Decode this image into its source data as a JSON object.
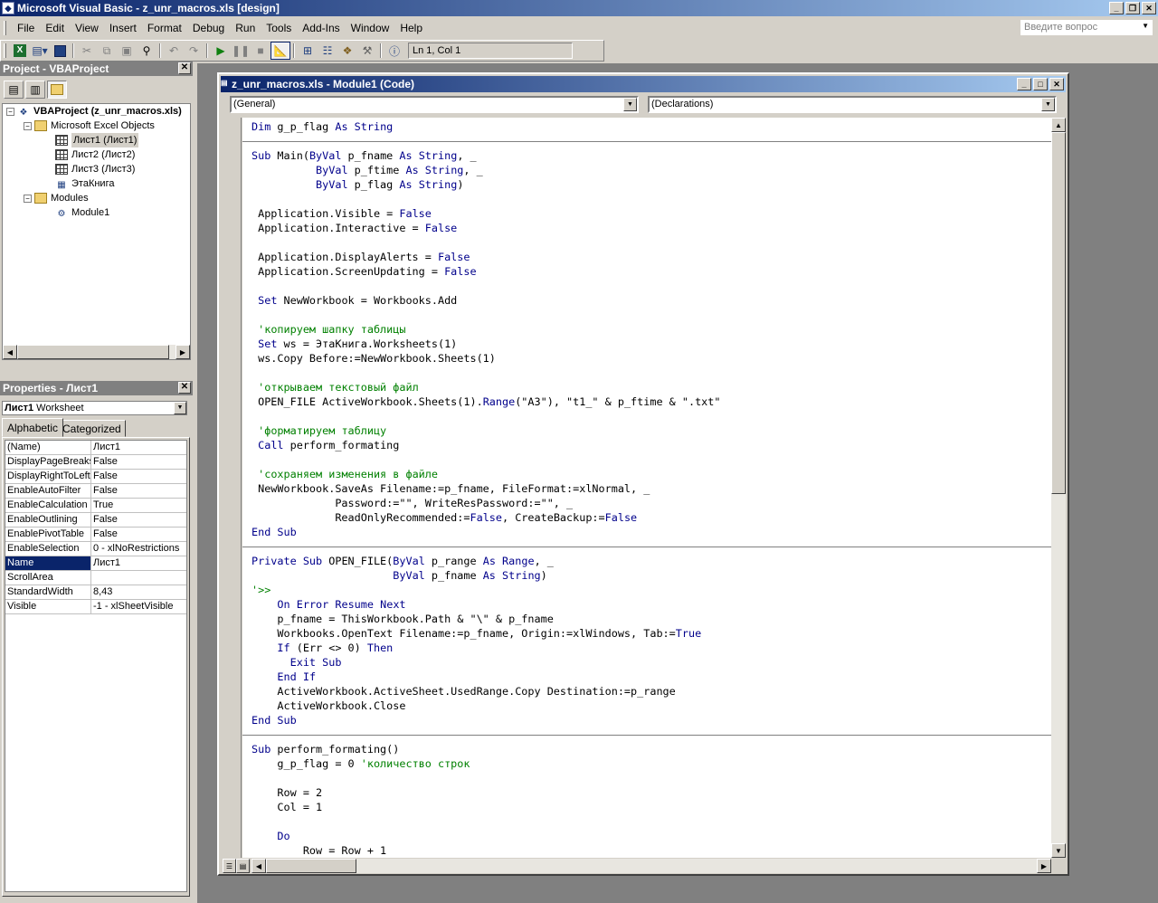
{
  "app": {
    "title": "Microsoft Visual Basic - z_unr_macros.xls [design]",
    "icon": "vb-app-icon"
  },
  "menu": [
    "File",
    "Edit",
    "View",
    "Insert",
    "Format",
    "Debug",
    "Run",
    "Tools",
    "Add-Ins",
    "Window",
    "Help"
  ],
  "help_placeholder": "Введите вопрос",
  "toolbar": {
    "status": "Ln 1, Col 1"
  },
  "project": {
    "title": "Project - VBAProject",
    "tree": [
      {
        "label": "VBAProject (z_unr_macros.xls)",
        "bold": true
      },
      {
        "label": "Microsoft Excel Objects"
      },
      {
        "label": "Лист1 (Лист1)"
      },
      {
        "label": "Лист2 (Лист2)"
      },
      {
        "label": "Лист3 (Лист3)"
      },
      {
        "label": "ЭтаКнига"
      },
      {
        "label": "Modules"
      },
      {
        "label": "Module1"
      }
    ]
  },
  "properties": {
    "title": "Properties - Лист1",
    "object": "Лист1",
    "object_type": "Worksheet",
    "tabs": [
      "Alphabetic",
      "Categorized"
    ],
    "rows": [
      {
        "name": "(Name)",
        "value": "Лист1"
      },
      {
        "name": "DisplayPageBreaks",
        "value": "False"
      },
      {
        "name": "DisplayRightToLeft",
        "value": "False"
      },
      {
        "name": "EnableAutoFilter",
        "value": "False"
      },
      {
        "name": "EnableCalculation",
        "value": "True"
      },
      {
        "name": "EnableOutlining",
        "value": "False"
      },
      {
        "name": "EnablePivotTable",
        "value": "False"
      },
      {
        "name": "EnableSelection",
        "value": "0 - xlNoRestrictions"
      },
      {
        "name": "Name",
        "value": "Лист1",
        "selected": true
      },
      {
        "name": "ScrollArea",
        "value": ""
      },
      {
        "name": "StandardWidth",
        "value": "8,43"
      },
      {
        "name": "Visible",
        "value": "-1 - xlSheetVisible"
      }
    ]
  },
  "code_window": {
    "title": "z_unr_macros.xls - Module1 (Code)",
    "object_combo": "(General)",
    "procedure_combo": "(Declarations)",
    "lines": [
      "Dim g_p_flag As String",
      "---",
      "Sub Main(ByVal p_fname As String, _",
      "          ByVal p_ftime As String, _",
      "          ByVal p_flag As String)",
      "",
      " Application.Visible = False",
      " Application.Interactive = False",
      "",
      " Application.DisplayAlerts = False",
      " Application.ScreenUpdating = False",
      "",
      " Set NewWorkbook = Workbooks.Add",
      "",
      " 'копируем шапку таблицы",
      " Set ws = ЭтаКнига.Worksheets(1)",
      " ws.Copy Before:=NewWorkbook.Sheets(1)",
      "",
      " 'открываем текстовый файл",
      " OPEN_FILE ActiveWorkbook.Sheets(1).Range(\"A3\"), \"t1_\" & p_ftime & \".txt\"",
      "",
      " 'форматируем таблицу",
      " Call perform_formating",
      "",
      " 'сохраняем изменения в файле",
      " NewWorkbook.SaveAs Filename:=p_fname, FileFormat:=xlNormal, _",
      "             Password:=\"\", WriteResPassword:=\"\", _",
      "             ReadOnlyRecommended:=False, CreateBackup:=False",
      "End Sub",
      "---",
      "Private Sub OPEN_FILE(ByVal p_range As Range, _",
      "                      ByVal p_fname As String)",
      "'>>",
      "    On Error Resume Next",
      "    p_fname = ThisWorkbook.Path & \"\\\" & p_fname",
      "    Workbooks.OpenText Filename:=p_fname, Origin:=xlWindows, Tab:=True",
      "    If (Err <> 0) Then",
      "      Exit Sub",
      "    End If",
      "    ActiveWorkbook.ActiveSheet.UsedRange.Copy Destination:=p_range",
      "    ActiveWorkbook.Close",
      "End Sub",
      "---",
      "Sub perform_formating()",
      "    g_p_flag = 0 'количество строк",
      "",
      "    Row = 2",
      "    Col = 1",
      "",
      "    Do",
      "        Row = Row + 1"
    ]
  }
}
